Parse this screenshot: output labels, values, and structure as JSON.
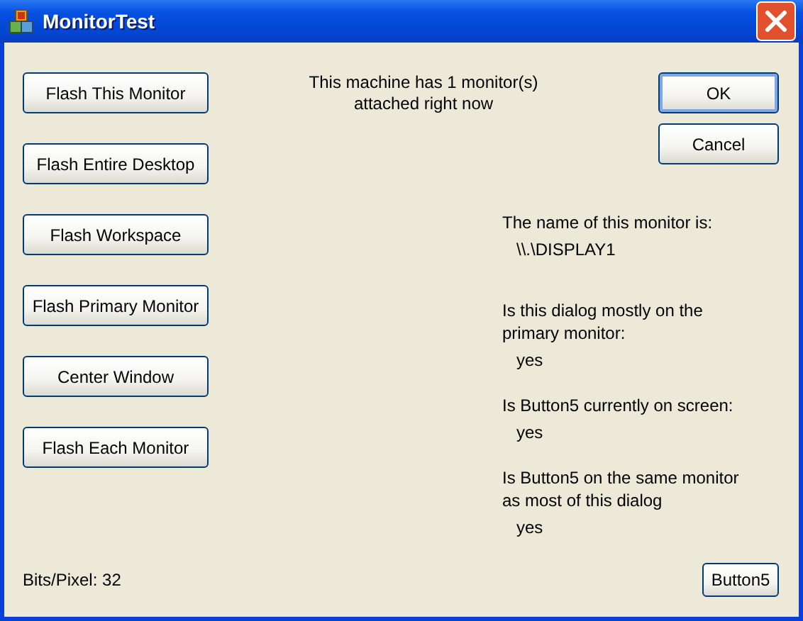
{
  "window": {
    "title": "MonitorTest"
  },
  "action_buttons": [
    "Flash This Monitor",
    "Flash Entire Desktop",
    "Flash Workspace",
    "Flash Primary Monitor",
    "Center Window",
    "Flash Each Monitor"
  ],
  "message": "This machine has 1 monitor(s)\nattached right now",
  "dialog_buttons": [
    {
      "label": "OK",
      "default": true
    },
    {
      "label": "Cancel",
      "default": false
    }
  ],
  "info": [
    {
      "label": "The name of this monitor is:",
      "value": "\\\\.\\DISPLAY1"
    },
    {
      "label": "Is this dialog mostly on the\nprimary monitor:",
      "value": "yes"
    },
    {
      "label": "Is Button5 currently on screen:",
      "value": "yes"
    },
    {
      "label": "Is Button5 on the same monitor\nas most of this dialog",
      "value": "yes"
    }
  ],
  "bits_per_pixel": "Bits/Pixel: 32",
  "button5": "Button5"
}
